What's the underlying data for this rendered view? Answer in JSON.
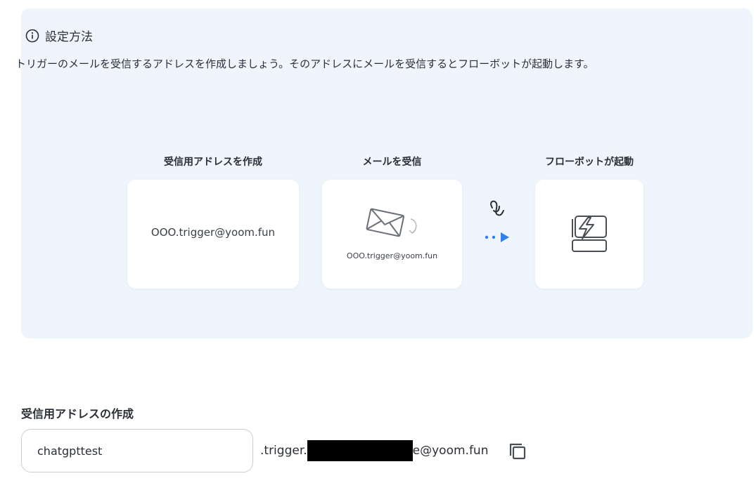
{
  "info": {
    "title": "設定方法",
    "description": "トリガーのメールを受信するアドレスを作成しましょう。そのアドレスにメールを受信するとフローボットが起動します。",
    "icon": "info-circle-icon"
  },
  "steps": [
    {
      "label": "受信用アドレスを作成",
      "email": "OOO.trigger@yoom.fun"
    },
    {
      "label": "メールを受信",
      "email": "OOO.trigger@yoom.fun",
      "icon": "envelope-icon"
    },
    {
      "label": "フローボットが起動",
      "icon": "flowbot-lightning-icon"
    }
  ],
  "address_section": {
    "label": "受信用アドレスの作成",
    "input_value": "chatgpttest",
    "suffix_prefix": ".trigger.",
    "suffix_end": "e@yoom.fun",
    "copy_icon": "copy-icon"
  },
  "colors": {
    "panel_bg": "#eef5fd",
    "accent": "#2f80ed",
    "text": "#2b2f36"
  }
}
